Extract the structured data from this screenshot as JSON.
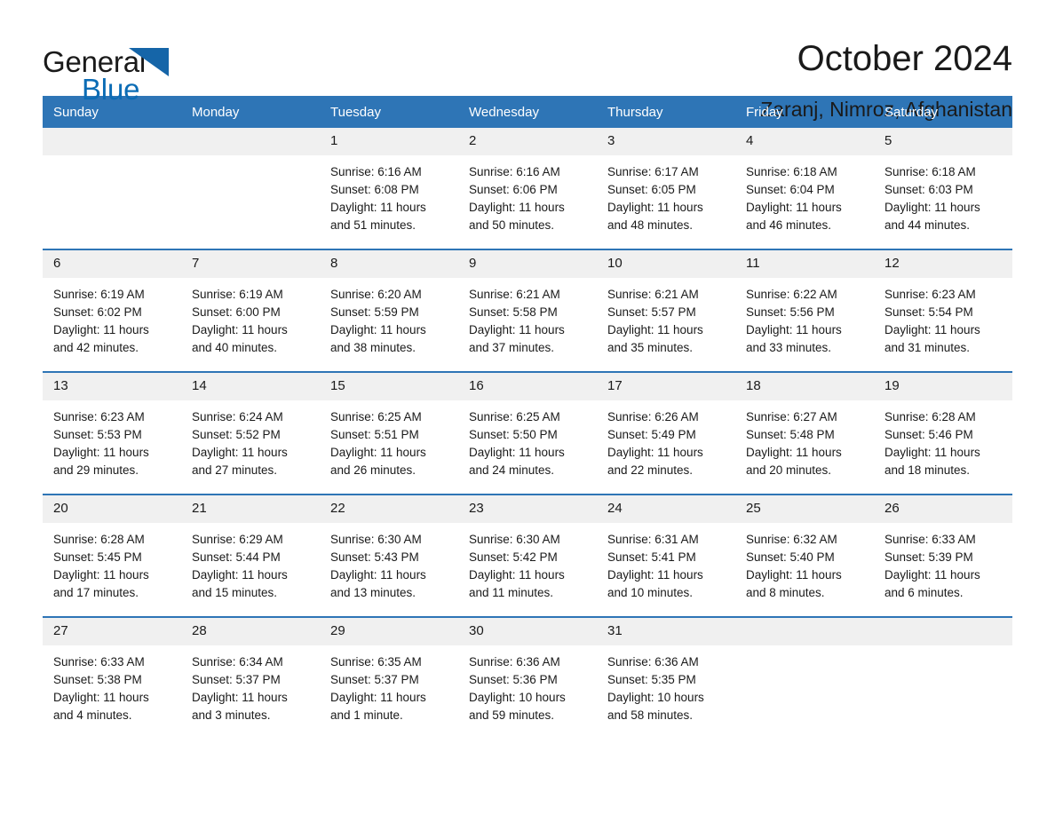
{
  "brand": {
    "name_top": "General",
    "name_bottom": "Blue",
    "triangle_color": "#1565a8",
    "blue_text_color": "#0b6cb5"
  },
  "header": {
    "title": "October 2024",
    "location": "Zaranj, Nimroz, Afghanistan"
  },
  "theme": {
    "header_blue": "#2e75b6",
    "daynum_band": "#f0f0f0",
    "text": "#1a1a1a"
  },
  "calendar": {
    "weekday_headers": [
      "Sunday",
      "Monday",
      "Tuesday",
      "Wednesday",
      "Thursday",
      "Friday",
      "Saturday"
    ],
    "weeks": [
      [
        {
          "day": "",
          "sunrise": "",
          "sunset": "",
          "daylight_line1": "",
          "daylight_line2": "",
          "empty": true
        },
        {
          "day": "",
          "sunrise": "",
          "sunset": "",
          "daylight_line1": "",
          "daylight_line2": "",
          "empty": true
        },
        {
          "day": "1",
          "sunrise": "Sunrise: 6:16 AM",
          "sunset": "Sunset: 6:08 PM",
          "daylight_line1": "Daylight: 11 hours",
          "daylight_line2": "and 51 minutes."
        },
        {
          "day": "2",
          "sunrise": "Sunrise: 6:16 AM",
          "sunset": "Sunset: 6:06 PM",
          "daylight_line1": "Daylight: 11 hours",
          "daylight_line2": "and 50 minutes."
        },
        {
          "day": "3",
          "sunrise": "Sunrise: 6:17 AM",
          "sunset": "Sunset: 6:05 PM",
          "daylight_line1": "Daylight: 11 hours",
          "daylight_line2": "and 48 minutes."
        },
        {
          "day": "4",
          "sunrise": "Sunrise: 6:18 AM",
          "sunset": "Sunset: 6:04 PM",
          "daylight_line1": "Daylight: 11 hours",
          "daylight_line2": "and 46 minutes."
        },
        {
          "day": "5",
          "sunrise": "Sunrise: 6:18 AM",
          "sunset": "Sunset: 6:03 PM",
          "daylight_line1": "Daylight: 11 hours",
          "daylight_line2": "and 44 minutes."
        }
      ],
      [
        {
          "day": "6",
          "sunrise": "Sunrise: 6:19 AM",
          "sunset": "Sunset: 6:02 PM",
          "daylight_line1": "Daylight: 11 hours",
          "daylight_line2": "and 42 minutes."
        },
        {
          "day": "7",
          "sunrise": "Sunrise: 6:19 AM",
          "sunset": "Sunset: 6:00 PM",
          "daylight_line1": "Daylight: 11 hours",
          "daylight_line2": "and 40 minutes."
        },
        {
          "day": "8",
          "sunrise": "Sunrise: 6:20 AM",
          "sunset": "Sunset: 5:59 PM",
          "daylight_line1": "Daylight: 11 hours",
          "daylight_line2": "and 38 minutes."
        },
        {
          "day": "9",
          "sunrise": "Sunrise: 6:21 AM",
          "sunset": "Sunset: 5:58 PM",
          "daylight_line1": "Daylight: 11 hours",
          "daylight_line2": "and 37 minutes."
        },
        {
          "day": "10",
          "sunrise": "Sunrise: 6:21 AM",
          "sunset": "Sunset: 5:57 PM",
          "daylight_line1": "Daylight: 11 hours",
          "daylight_line2": "and 35 minutes."
        },
        {
          "day": "11",
          "sunrise": "Sunrise: 6:22 AM",
          "sunset": "Sunset: 5:56 PM",
          "daylight_line1": "Daylight: 11 hours",
          "daylight_line2": "and 33 minutes."
        },
        {
          "day": "12",
          "sunrise": "Sunrise: 6:23 AM",
          "sunset": "Sunset: 5:54 PM",
          "daylight_line1": "Daylight: 11 hours",
          "daylight_line2": "and 31 minutes."
        }
      ],
      [
        {
          "day": "13",
          "sunrise": "Sunrise: 6:23 AM",
          "sunset": "Sunset: 5:53 PM",
          "daylight_line1": "Daylight: 11 hours",
          "daylight_line2": "and 29 minutes."
        },
        {
          "day": "14",
          "sunrise": "Sunrise: 6:24 AM",
          "sunset": "Sunset: 5:52 PM",
          "daylight_line1": "Daylight: 11 hours",
          "daylight_line2": "and 27 minutes."
        },
        {
          "day": "15",
          "sunrise": "Sunrise: 6:25 AM",
          "sunset": "Sunset: 5:51 PM",
          "daylight_line1": "Daylight: 11 hours",
          "daylight_line2": "and 26 minutes."
        },
        {
          "day": "16",
          "sunrise": "Sunrise: 6:25 AM",
          "sunset": "Sunset: 5:50 PM",
          "daylight_line1": "Daylight: 11 hours",
          "daylight_line2": "and 24 minutes."
        },
        {
          "day": "17",
          "sunrise": "Sunrise: 6:26 AM",
          "sunset": "Sunset: 5:49 PM",
          "daylight_line1": "Daylight: 11 hours",
          "daylight_line2": "and 22 minutes."
        },
        {
          "day": "18",
          "sunrise": "Sunrise: 6:27 AM",
          "sunset": "Sunset: 5:48 PM",
          "daylight_line1": "Daylight: 11 hours",
          "daylight_line2": "and 20 minutes."
        },
        {
          "day": "19",
          "sunrise": "Sunrise: 6:28 AM",
          "sunset": "Sunset: 5:46 PM",
          "daylight_line1": "Daylight: 11 hours",
          "daylight_line2": "and 18 minutes."
        }
      ],
      [
        {
          "day": "20",
          "sunrise": "Sunrise: 6:28 AM",
          "sunset": "Sunset: 5:45 PM",
          "daylight_line1": "Daylight: 11 hours",
          "daylight_line2": "and 17 minutes."
        },
        {
          "day": "21",
          "sunrise": "Sunrise: 6:29 AM",
          "sunset": "Sunset: 5:44 PM",
          "daylight_line1": "Daylight: 11 hours",
          "daylight_line2": "and 15 minutes."
        },
        {
          "day": "22",
          "sunrise": "Sunrise: 6:30 AM",
          "sunset": "Sunset: 5:43 PM",
          "daylight_line1": "Daylight: 11 hours",
          "daylight_line2": "and 13 minutes."
        },
        {
          "day": "23",
          "sunrise": "Sunrise: 6:30 AM",
          "sunset": "Sunset: 5:42 PM",
          "daylight_line1": "Daylight: 11 hours",
          "daylight_line2": "and 11 minutes."
        },
        {
          "day": "24",
          "sunrise": "Sunrise: 6:31 AM",
          "sunset": "Sunset: 5:41 PM",
          "daylight_line1": "Daylight: 11 hours",
          "daylight_line2": "and 10 minutes."
        },
        {
          "day": "25",
          "sunrise": "Sunrise: 6:32 AM",
          "sunset": "Sunset: 5:40 PM",
          "daylight_line1": "Daylight: 11 hours",
          "daylight_line2": "and 8 minutes."
        },
        {
          "day": "26",
          "sunrise": "Sunrise: 6:33 AM",
          "sunset": "Sunset: 5:39 PM",
          "daylight_line1": "Daylight: 11 hours",
          "daylight_line2": "and 6 minutes."
        }
      ],
      [
        {
          "day": "27",
          "sunrise": "Sunrise: 6:33 AM",
          "sunset": "Sunset: 5:38 PM",
          "daylight_line1": "Daylight: 11 hours",
          "daylight_line2": "and 4 minutes."
        },
        {
          "day": "28",
          "sunrise": "Sunrise: 6:34 AM",
          "sunset": "Sunset: 5:37 PM",
          "daylight_line1": "Daylight: 11 hours",
          "daylight_line2": "and 3 minutes."
        },
        {
          "day": "29",
          "sunrise": "Sunrise: 6:35 AM",
          "sunset": "Sunset: 5:37 PM",
          "daylight_line1": "Daylight: 11 hours",
          "daylight_line2": "and 1 minute."
        },
        {
          "day": "30",
          "sunrise": "Sunrise: 6:36 AM",
          "sunset": "Sunset: 5:36 PM",
          "daylight_line1": "Daylight: 10 hours",
          "daylight_line2": "and 59 minutes."
        },
        {
          "day": "31",
          "sunrise": "Sunrise: 6:36 AM",
          "sunset": "Sunset: 5:35 PM",
          "daylight_line1": "Daylight: 10 hours",
          "daylight_line2": "and 58 minutes."
        },
        {
          "day": "",
          "sunrise": "",
          "sunset": "",
          "daylight_line1": "",
          "daylight_line2": "",
          "empty": true
        },
        {
          "day": "",
          "sunrise": "",
          "sunset": "",
          "daylight_line1": "",
          "daylight_line2": "",
          "empty": true
        }
      ]
    ]
  }
}
